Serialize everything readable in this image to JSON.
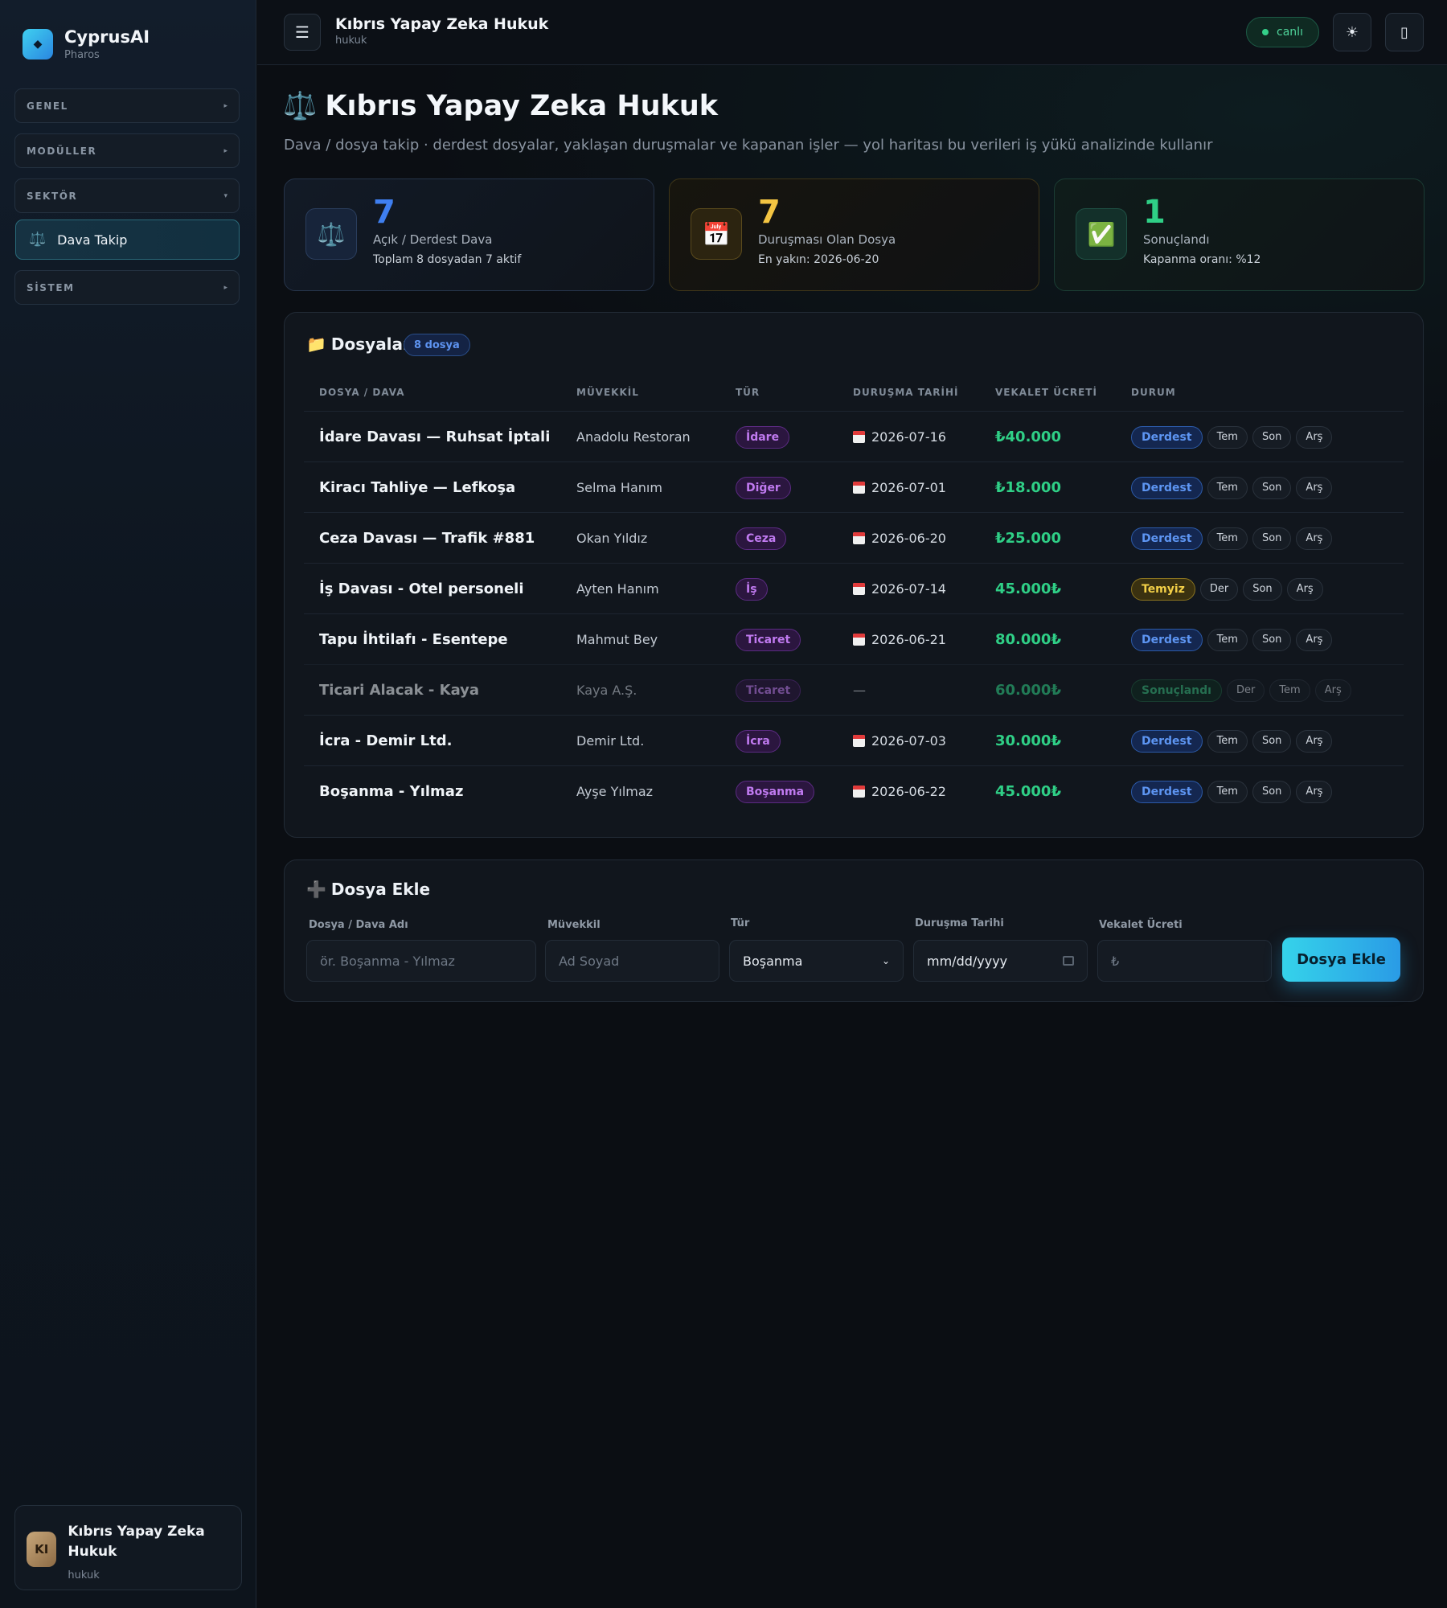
{
  "brand": {
    "name": "CyprusAI",
    "sub": "Pharos",
    "logo_icon": "◆"
  },
  "sidebar": {
    "groups": [
      {
        "label": "GENEL",
        "arrow": "▸"
      },
      {
        "label": "MODÜLLER",
        "arrow": "▸"
      },
      {
        "label": "SEKTÖR",
        "arrow": "▾"
      },
      {
        "label": "SİSTEM",
        "arrow": "▸"
      }
    ],
    "active_item": {
      "icon": "⚖️",
      "label": "Dava Takip"
    }
  },
  "user": {
    "initials": "KI",
    "name": "Kıbrıs Yapay Zeka Hukuk",
    "role": "hukuk"
  },
  "topbar": {
    "menu_icon": "☰",
    "title": "Kıbrıs Yapay Zeka Hukuk",
    "subtitle": "hukuk",
    "live_label": "canlı",
    "theme_icon": "☀",
    "device_icon": "▯"
  },
  "page": {
    "title_icon": "⚖️",
    "title": "Kıbrıs Yapay Zeka Hukuk",
    "description": "Dava / dosya takip · derdest dosyalar, yaklaşan duruşmalar ve kapanan işler — yol haritası bu verileri iş yükü analizinde kullanır"
  },
  "stats": [
    {
      "icon": "⚖️",
      "value": "7",
      "label": "Açık / Derdest Dava",
      "sub": "Toplam 8 dosyadan 7 aktif",
      "color": "#3f7ff0"
    },
    {
      "icon": "📅",
      "value": "7",
      "label": "Duruşması Olan Dosya",
      "sub": "En yakın: 2026-06-20",
      "color": "#f4c542"
    },
    {
      "icon": "✅",
      "value": "1",
      "label": "Sonuçlandı",
      "sub": "Kapanma oranı: %12",
      "color": "#2fcf86"
    }
  ],
  "files_panel": {
    "icon": "📁",
    "title": "Dosyalar",
    "count_badge": "8 dosya",
    "headers": [
      "DOSYA / DAVA",
      "MÜVEKKİL",
      "TÜR",
      "DURUŞMA TARİHİ",
      "VEKALET ÜCRETİ",
      "DURUM"
    ],
    "rows": [
      {
        "name": "İdare Davası — Ruhsat İptali",
        "client": "Anadolu Restoran",
        "type": "İdare",
        "date": "2026-07-16",
        "fee": "₺40.000",
        "status": "Derdest",
        "status_color": "blue",
        "actions": [
          "Tem",
          "Son",
          "Arş"
        ],
        "dim": false
      },
      {
        "name": "Kiracı Tahliye — Lefkoşa",
        "client": "Selma Hanım",
        "type": "Diğer",
        "date": "2026-07-01",
        "fee": "₺18.000",
        "status": "Derdest",
        "status_color": "blue",
        "actions": [
          "Tem",
          "Son",
          "Arş"
        ],
        "dim": false
      },
      {
        "name": "Ceza Davası — Trafik #881",
        "client": "Okan Yıldız",
        "type": "Ceza",
        "date": "2026-06-20",
        "fee": "₺25.000",
        "status": "Derdest",
        "status_color": "blue",
        "actions": [
          "Tem",
          "Son",
          "Arş"
        ],
        "dim": false
      },
      {
        "name": "İş Davası - Otel personeli",
        "client": "Ayten Hanım",
        "type": "İş",
        "date": "2026-07-14",
        "fee": "45.000₺",
        "status": "Temyiz",
        "status_color": "yellow",
        "actions": [
          "Der",
          "Son",
          "Arş"
        ],
        "dim": false
      },
      {
        "name": "Tapu İhtilafı - Esentepe",
        "client": "Mahmut Bey",
        "type": "Ticaret",
        "date": "2026-06-21",
        "fee": "80.000₺",
        "status": "Derdest",
        "status_color": "blue",
        "actions": [
          "Tem",
          "Son",
          "Arş"
        ],
        "dim": false
      },
      {
        "name": "Ticari Alacak - Kaya",
        "client": "Kaya A.Ş.",
        "type": "Ticaret",
        "date": "—",
        "fee": "60.000₺",
        "status": "Sonuçlandı",
        "status_color": "green",
        "actions": [
          "Der",
          "Tem",
          "Arş"
        ],
        "dim": true
      },
      {
        "name": "İcra - Demir Ltd.",
        "client": "Demir Ltd.",
        "type": "İcra",
        "date": "2026-07-03",
        "fee": "30.000₺",
        "status": "Derdest",
        "status_color": "blue",
        "actions": [
          "Tem",
          "Son",
          "Arş"
        ],
        "dim": false
      },
      {
        "name": "Boşanma - Yılmaz",
        "client": "Ayşe Yılmaz",
        "type": "Boşanma",
        "date": "2026-06-22",
        "fee": "45.000₺",
        "status": "Derdest",
        "status_color": "blue",
        "actions": [
          "Tem",
          "Son",
          "Arş"
        ],
        "dim": false
      }
    ]
  },
  "add_form": {
    "icon": "➕",
    "title": "Dosya Ekle",
    "name_label": "Dosya / Dava Adı",
    "name_placeholder": "ör. Boşanma - Yılmaz",
    "client_label": "Müvekkil",
    "client_placeholder": "Ad Soyad",
    "type_label": "Tür",
    "type_value": "Boşanma",
    "type_options": [
      "Boşanma"
    ],
    "date_label": "Duruşma Tarihi",
    "date_placeholder": "mm/dd/yyyy",
    "fee_label": "Vekalet Ücreti",
    "fee_placeholder": "₺",
    "submit_label": "Dosya Ekle"
  }
}
